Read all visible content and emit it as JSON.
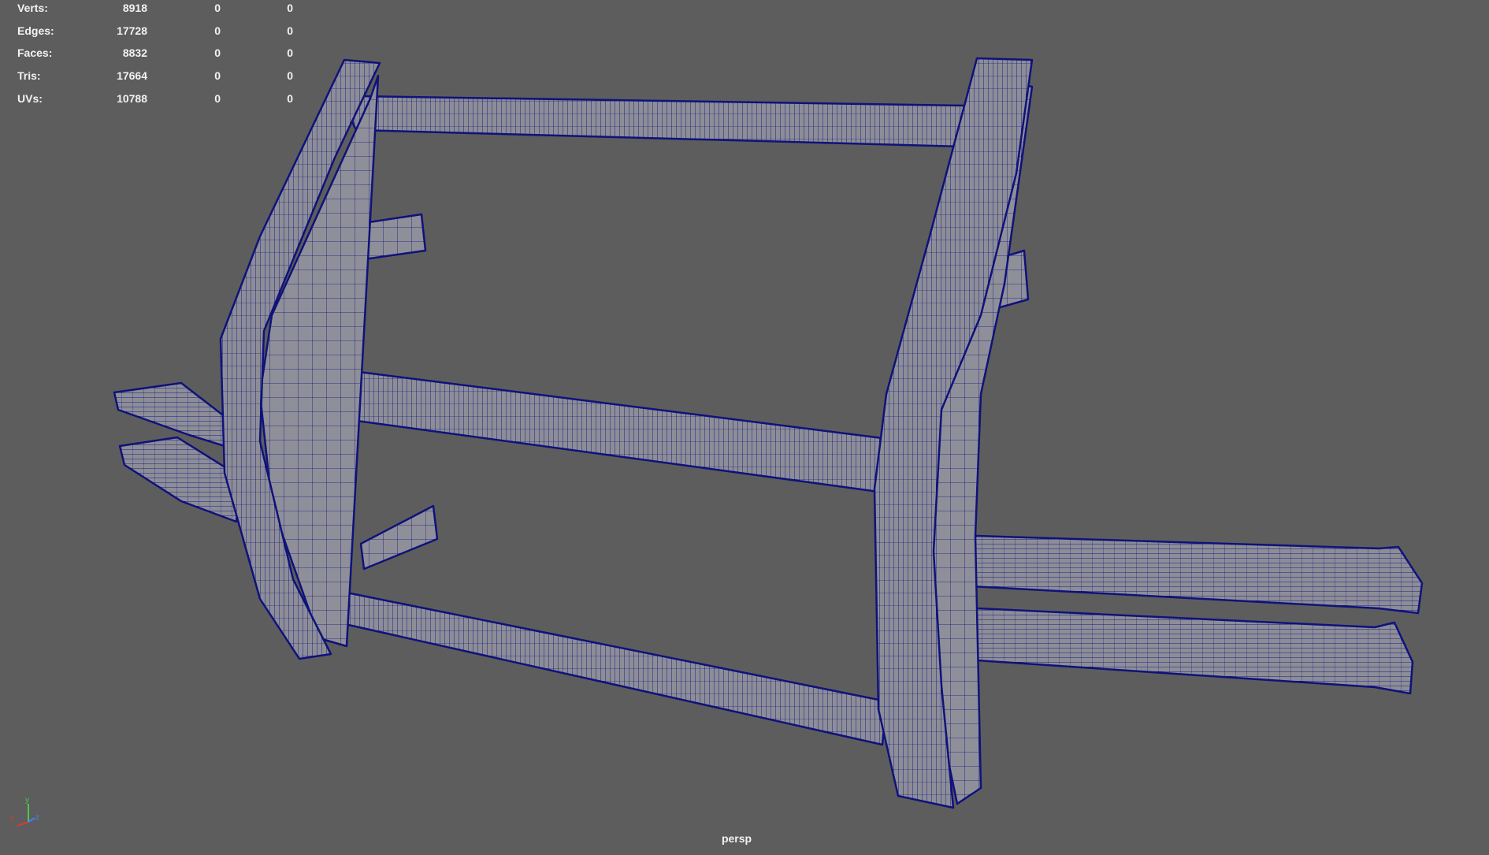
{
  "hud": {
    "rows": [
      {
        "label": "Verts:",
        "v1": "8918",
        "v2": "0",
        "v3": "0"
      },
      {
        "label": "Edges:",
        "v1": "17728",
        "v2": "0",
        "v3": "0"
      },
      {
        "label": "Faces:",
        "v1": "8832",
        "v2": "0",
        "v3": "0"
      },
      {
        "label": "Tris:",
        "v1": "17664",
        "v2": "0",
        "v3": "0"
      },
      {
        "label": "UVs:",
        "v1": "10788",
        "v2": "0",
        "v3": "0"
      }
    ]
  },
  "viewport": {
    "camera": "persp",
    "background_color": "#5d5d5d",
    "wire_color": "#0f127a",
    "surface_color": "#8d8d98"
  },
  "axis": {
    "x_label": "x",
    "y_label": "y",
    "z_label": "z",
    "x_color": "#d63a3a",
    "y_color": "#4cc74c",
    "z_color": "#4a7dff"
  },
  "model": {
    "parts": [
      "top-tube",
      "left-upright",
      "right-upright",
      "middle-crossbar",
      "bottom-tube",
      "left-upper-bracket",
      "left-lower-bracket",
      "right-upper-bracket",
      "left-arms",
      "right-arms"
    ]
  }
}
